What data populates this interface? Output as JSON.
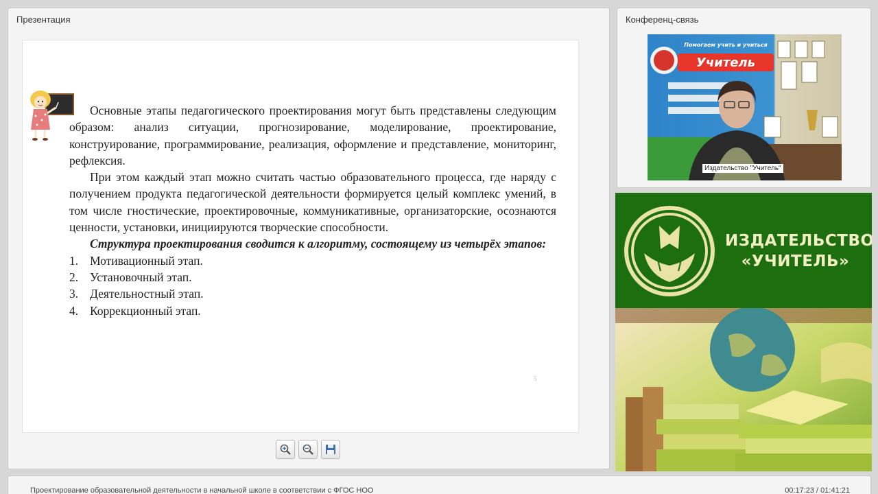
{
  "presentation": {
    "title": "Презентация",
    "slide": {
      "paragraph1": "Основные этапы педагогического проектирования могут быть представлены следующим образом: анализ ситуации, прогнозирование, моделирование, проектирование, конструирование, программирование, реализация, оформление и представление, мониторинг, рефлексия.",
      "paragraph2": "При этом каждый этап можно считать частью образовательного процесса, где наряду с получением продукта педагогической деятельности формируется целый комплекс умений, в том числе гностические, проектировочные, коммуникативные, организаторские, осознаются ценности, установки, инициируются творческие способности.",
      "paragraph3": "Структура проектирования сводится к алгоритму, состоящему из четырёх этапов:",
      "list": [
        {
          "num": "1.",
          "text": "Мотивационный этап."
        },
        {
          "num": "2.",
          "text": "Установочный этап."
        },
        {
          "num": "3.",
          "text": "Деятельностный этап."
        },
        {
          "num": "4.",
          "text": "Коррекционный этап."
        }
      ],
      "page_number": "5"
    },
    "toolbar": {
      "zoom_in_icon": "zoom-in-icon",
      "zoom_out_icon": "zoom-out-icon",
      "save_icon": "floppy-disk-icon"
    }
  },
  "conference": {
    "title": "Конференц-связь",
    "video": {
      "presenter_label": "Издательство \"Учитель\"",
      "banner_text_line1": "Помогаем учить и учиться",
      "banner_text_line2": "Учитель"
    }
  },
  "banner": {
    "line1": "ИЗДАТЕЛЬСТВО",
    "line2": "«УЧИТЕЛЬ»"
  },
  "footer": {
    "title": "Проектирование образовательной деятельности в начальной школе в соответствии с ФГОС НОО",
    "time": "00:17:23 / 01:41:21"
  },
  "colors": {
    "banner_green": "#1d6e0f",
    "banner_text": "#f3efc4"
  }
}
